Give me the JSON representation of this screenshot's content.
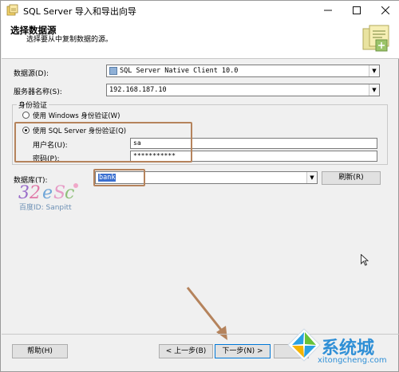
{
  "window": {
    "title": "SQL Server 导入和导出向导",
    "minimize_icon": "minimize-icon",
    "maximize_icon": "maximize-icon",
    "close_icon": "close-icon"
  },
  "header": {
    "title": "选择数据源",
    "subtitle": "选择要从中复制数据的源。"
  },
  "form": {
    "data_source_label": "数据源(D):",
    "data_source_value": "SQL Server Native Client 10.0",
    "server_name_label": "服务器名称(S):",
    "server_name_value": "192.168.187.10",
    "auth_group_label": "身份验证",
    "windows_auth_label": "使用 Windows 身份验证(W)",
    "sql_auth_label": "使用 SQL Server 身份验证(Q)",
    "username_label": "用户名(U):",
    "username_value": "sa",
    "password_label": "密码(P):",
    "password_value": "***********",
    "database_label": "数据库(T):",
    "database_value": "bank",
    "refresh_label": "刷新(R)"
  },
  "footer": {
    "help_label": "帮助(H)",
    "back_label": "< 上一步(B)",
    "next_label": "下一步(N) >"
  },
  "watermarks": {
    "baidu_id": "百度ID: Sanpitt",
    "site_name": "系统城",
    "site_url": "xitongcheng.com"
  },
  "colors": {
    "highlight_border": "#b5835c",
    "arrow": "#b5835c"
  }
}
